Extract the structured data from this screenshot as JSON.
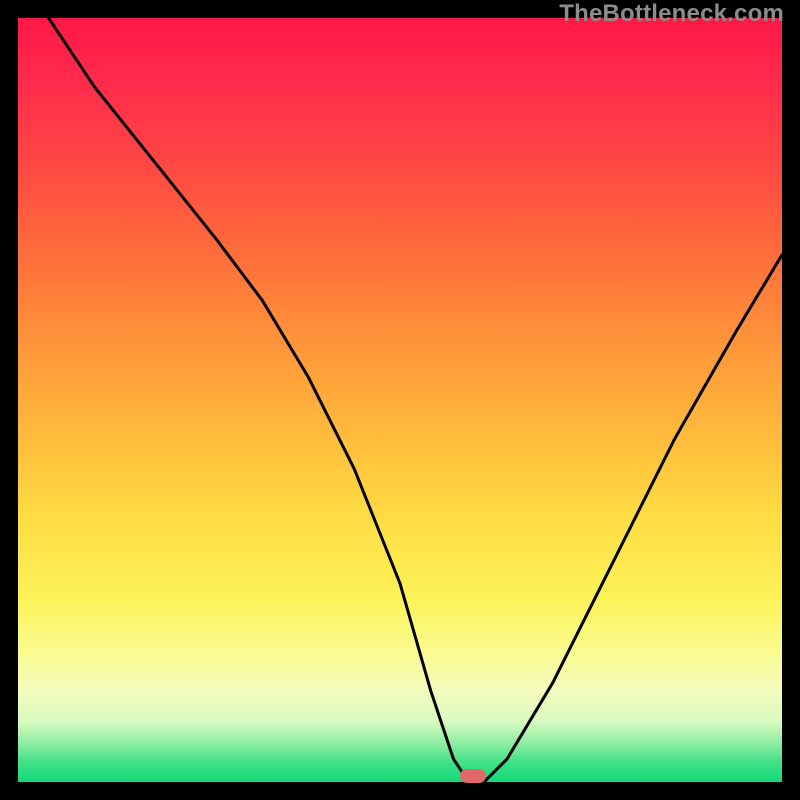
{
  "watermark": "TheBottleneck.com",
  "marker": {
    "x_pct": 59.5,
    "y_pct": 99.2
  },
  "chart_data": {
    "type": "line",
    "title": "",
    "xlabel": "",
    "ylabel": "",
    "xlim": [
      0,
      100
    ],
    "ylim": [
      0,
      100
    ],
    "grid": false,
    "note": "Bottleneck severity curve over a red-to-green vertical gradient; the ~0 trough is at x≈59, rising steeply on both sides. Values are percentages read from the vertical position (0=bottom/green, 100=top/red). No axis ticks or labels are rendered in the source image; values are estimated from pixel positions.",
    "series": [
      {
        "name": "bottleneck_curve",
        "x": [
          4,
          10,
          18,
          26,
          32,
          38,
          44,
          50,
          54,
          57,
          59,
          61,
          64,
          70,
          78,
          86,
          94,
          100
        ],
        "y": [
          100,
          91,
          81,
          71,
          63,
          53,
          41,
          26,
          12,
          3,
          0,
          0,
          3,
          13,
          29,
          45,
          59,
          69
        ]
      }
    ],
    "marker_point": {
      "x": 59.5,
      "y": 0.8
    },
    "gradient_stops": [
      {
        "pct": 0,
        "color": "#ff1846"
      },
      {
        "pct": 18,
        "color": "#ff4445"
      },
      {
        "pct": 42,
        "color": "#ff933a"
      },
      {
        "pct": 65,
        "color": "#ffdb43"
      },
      {
        "pct": 88,
        "color": "#f5fbbc"
      },
      {
        "pct": 97,
        "color": "#3fe087"
      },
      {
        "pct": 100,
        "color": "#11d977"
      }
    ]
  }
}
